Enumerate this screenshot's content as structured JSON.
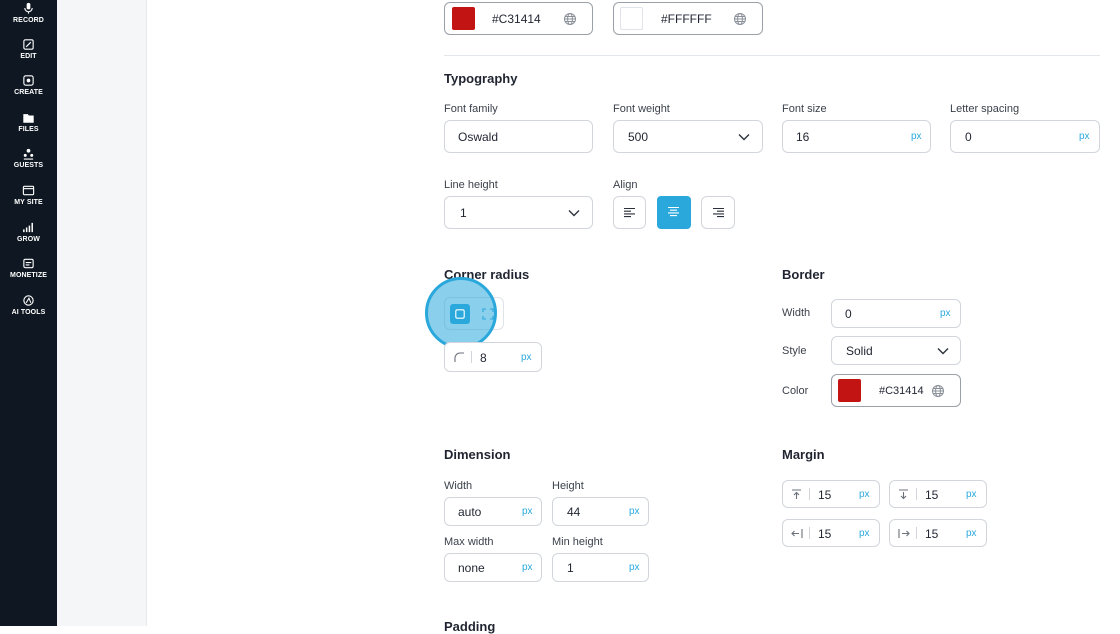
{
  "nav": [
    {
      "label": "RECORD",
      "icon": "microphone-icon"
    },
    {
      "label": "EDIT",
      "icon": "edit-icon"
    },
    {
      "label": "CREATE",
      "icon": "create-icon"
    },
    {
      "label": "FILES",
      "icon": "files-icon"
    },
    {
      "label": "GUESTS",
      "icon": "guests-icon"
    },
    {
      "label": "MY SITE",
      "icon": "site-icon"
    },
    {
      "label": "GROW",
      "icon": "grow-icon"
    },
    {
      "label": "MONETIZE",
      "icon": "monetize-icon"
    },
    {
      "label": "AI TOOLS",
      "icon": "ai-tools-icon"
    }
  ],
  "colors_top": {
    "color1": {
      "value": "#C31414",
      "swatch": "#C31414"
    },
    "color2": {
      "value": "#FFFFFF",
      "swatch": "#FFFFFF"
    }
  },
  "typography": {
    "heading": "Typography",
    "font_family_label": "Font family",
    "font_family_value": "Oswald",
    "font_weight_label": "Font weight",
    "font_weight_value": "500",
    "font_size_label": "Font size",
    "font_size_value": "16",
    "letter_spacing_label": "Letter spacing",
    "letter_spacing_value": "0",
    "line_height_label": "Line height",
    "line_height_value": "1",
    "align_label": "Align",
    "align_selected": "center"
  },
  "corner_radius": {
    "heading": "Corner radius",
    "value": "8",
    "mode_selected": "all-corners"
  },
  "border": {
    "heading": "Border",
    "width_label": "Width",
    "width_value": "0",
    "style_label": "Style",
    "style_value": "Solid",
    "color_label": "Color",
    "color_value": "#C31414",
    "color_swatch": "#C31414"
  },
  "dimension": {
    "heading": "Dimension",
    "width_label": "Width",
    "width_value": "auto",
    "height_label": "Height",
    "height_value": "44",
    "max_width_label": "Max width",
    "max_width_value": "none",
    "min_height_label": "Min height",
    "min_height_value": "1"
  },
  "margin": {
    "heading": "Margin",
    "top": "15",
    "bottom": "15",
    "left": "15",
    "right": "15"
  },
  "padding": {
    "heading": "Padding"
  },
  "unit": "px",
  "accent": "#2AA8DC"
}
